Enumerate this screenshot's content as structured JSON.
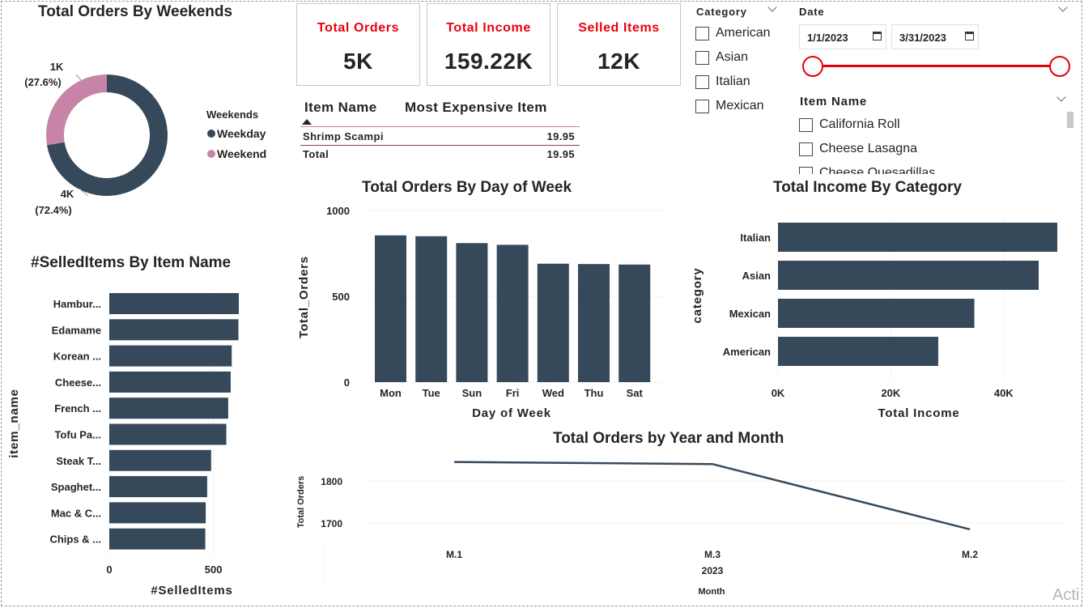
{
  "colors": {
    "dark": "#36495a",
    "pink": "#c884a6",
    "accent": "#e8000b",
    "text": "#252423"
  },
  "donut": {
    "title": "Total Orders By Weekends",
    "legend_title": "Weekends",
    "legend": [
      "Weekday",
      "Weekend"
    ],
    "weekend_label": "1K",
    "weekend_pct": "(27.6%)",
    "weekday_label": "4K",
    "weekday_pct": "(72.4%)"
  },
  "cards": [
    {
      "label": "Total Orders",
      "value": "5K"
    },
    {
      "label": "Total Income",
      "value": "159.22K"
    },
    {
      "label": "Selled Items",
      "value": "12K"
    }
  ],
  "category_slicer": {
    "title": "Category",
    "options": [
      "American",
      "Asian",
      "Italian",
      "Mexican"
    ]
  },
  "date_slicer": {
    "title": "Date",
    "start": "1/1/2023",
    "end": "3/31/2023"
  },
  "item_slicer": {
    "title": "Item Name",
    "options": [
      "California Roll",
      "Cheese Lasagna",
      "Cheese Quesadillas"
    ]
  },
  "table": {
    "col1": "Item Name",
    "col2": "Most Expensive Item",
    "row_name": "Shrimp Scampi",
    "row_value": "19.95",
    "total_label": "Total",
    "total_value": "19.95"
  },
  "chart_data": [
    {
      "type": "bar",
      "title": "Total Orders By Day of Week",
      "xlabel": "Day of Week",
      "ylabel": "Total_Orders",
      "categories": [
        "Mon",
        "Tue",
        "Sun",
        "Fri",
        "Wed",
        "Thu",
        "Sat"
      ],
      "values": [
        855,
        850,
        810,
        800,
        690,
        688,
        685
      ],
      "yticks": [
        "0",
        "500",
        "1000"
      ],
      "ylim": [
        0,
        1000
      ]
    },
    {
      "type": "bar",
      "orientation": "horizontal",
      "title": "Total Income By Category",
      "xlabel": "Total Income",
      "ylabel": "category",
      "categories": [
        "Italian",
        "Asian",
        "Mexican",
        "American"
      ],
      "values": [
        49500,
        46200,
        34800,
        28400
      ],
      "xticks": [
        "0K",
        "20K",
        "40K"
      ],
      "xlim": [
        0,
        49500
      ]
    },
    {
      "type": "bar",
      "orientation": "horizontal",
      "title": "#SelledItems By Item Name",
      "xlabel": "#SelledItems",
      "ylabel": "item_name",
      "categories": [
        "Hambur...",
        "Edamame",
        "Korean ...",
        "Cheese...",
        "French ...",
        "Tofu Pa...",
        "Steak T...",
        "Spaghet...",
        "Mac & C...",
        "Chips & ..."
      ],
      "values": [
        622,
        620,
        588,
        583,
        571,
        562,
        489,
        470,
        463,
        461
      ],
      "xticks": [
        "0",
        "500"
      ],
      "xlim": [
        0,
        622
      ]
    },
    {
      "type": "line",
      "title": "Total Orders by Year and Month",
      "xlabel": "Month",
      "ylabel": "Total Orders",
      "categories": [
        "M.1",
        "M.3",
        "M.2"
      ],
      "year": "2023",
      "values": [
        1845,
        1840,
        1685
      ],
      "yticks": [
        "1800",
        "1700"
      ],
      "ylim": [
        1650,
        1850
      ]
    }
  ]
}
